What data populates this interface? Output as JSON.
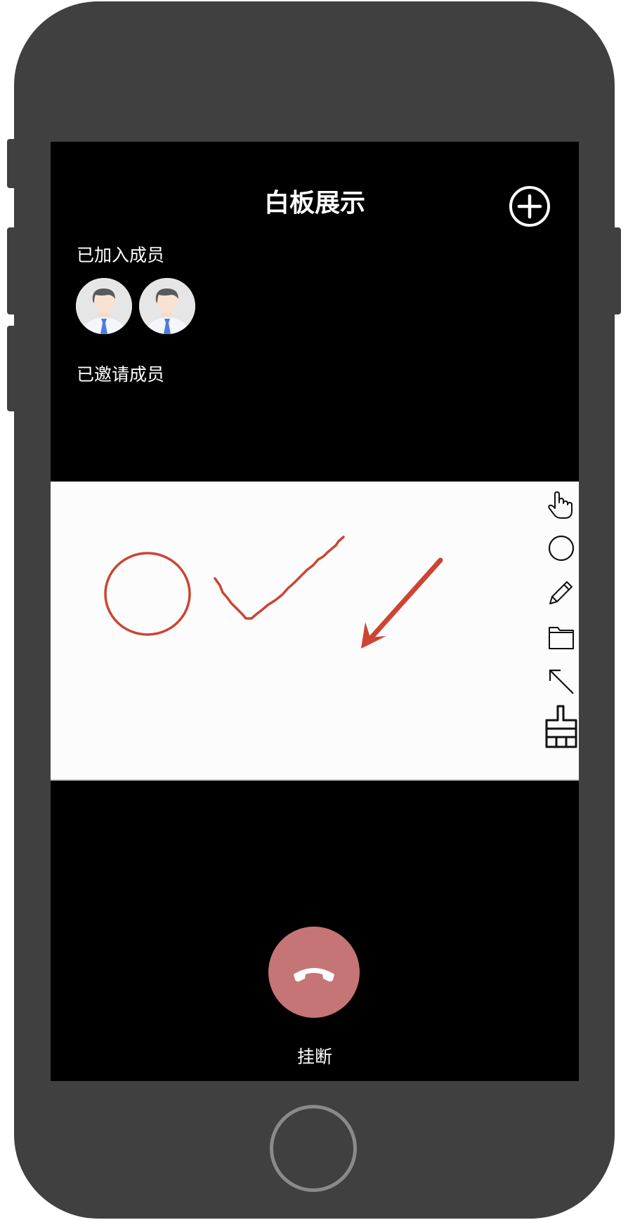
{
  "header": {
    "title": "白板展示"
  },
  "members": {
    "joined_label": "已加入成员",
    "invited_label": "已邀请成员",
    "joined_count": 2
  },
  "whiteboard": {
    "tools": [
      "hand-icon",
      "circle-icon",
      "pencil-icon",
      "folder-icon",
      "arrow-icon",
      "brush-icon"
    ],
    "stroke_color": "#cc4433"
  },
  "call": {
    "hangup_label": "挂断",
    "hangup_color": "#c57575"
  }
}
